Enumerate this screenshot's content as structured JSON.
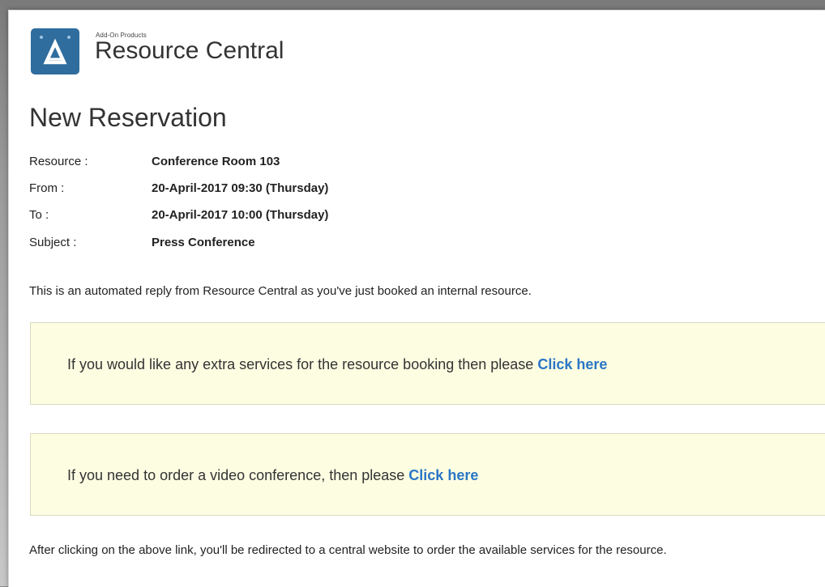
{
  "brand": {
    "tagline": "Add-On Products",
    "name": "Resource Central",
    "tile_color": "#2f6d9e",
    "logo_icon": "delta-triangle-icon"
  },
  "reservation": {
    "title": "New Reservation",
    "fields": [
      {
        "label": "Resource :",
        "value": "Conference Room 103"
      },
      {
        "label": "From :",
        "value": "20-April-2017 09:30 (Thursday)"
      },
      {
        "label": "To :",
        "value": "20-April-2017 10:00 (Thursday)"
      },
      {
        "label": "Subject :",
        "value": "Press Conference"
      }
    ]
  },
  "message": {
    "intro": "This is an automated reply from Resource Central as you've just booked an internal resource.",
    "callouts": [
      {
        "text": "If you would like any extra services for the resource booking then please ",
        "link_label": "Click here"
      },
      {
        "text": "If you need to order a video conference, then please ",
        "link_label": "Click here"
      }
    ],
    "outro": "After clicking on the above link, you'll be redirected to a central website to order the available services for the resource."
  },
  "colors": {
    "callout_background": "#fdfde2",
    "link": "#2a76c6",
    "accent": "#2f6d9e"
  }
}
